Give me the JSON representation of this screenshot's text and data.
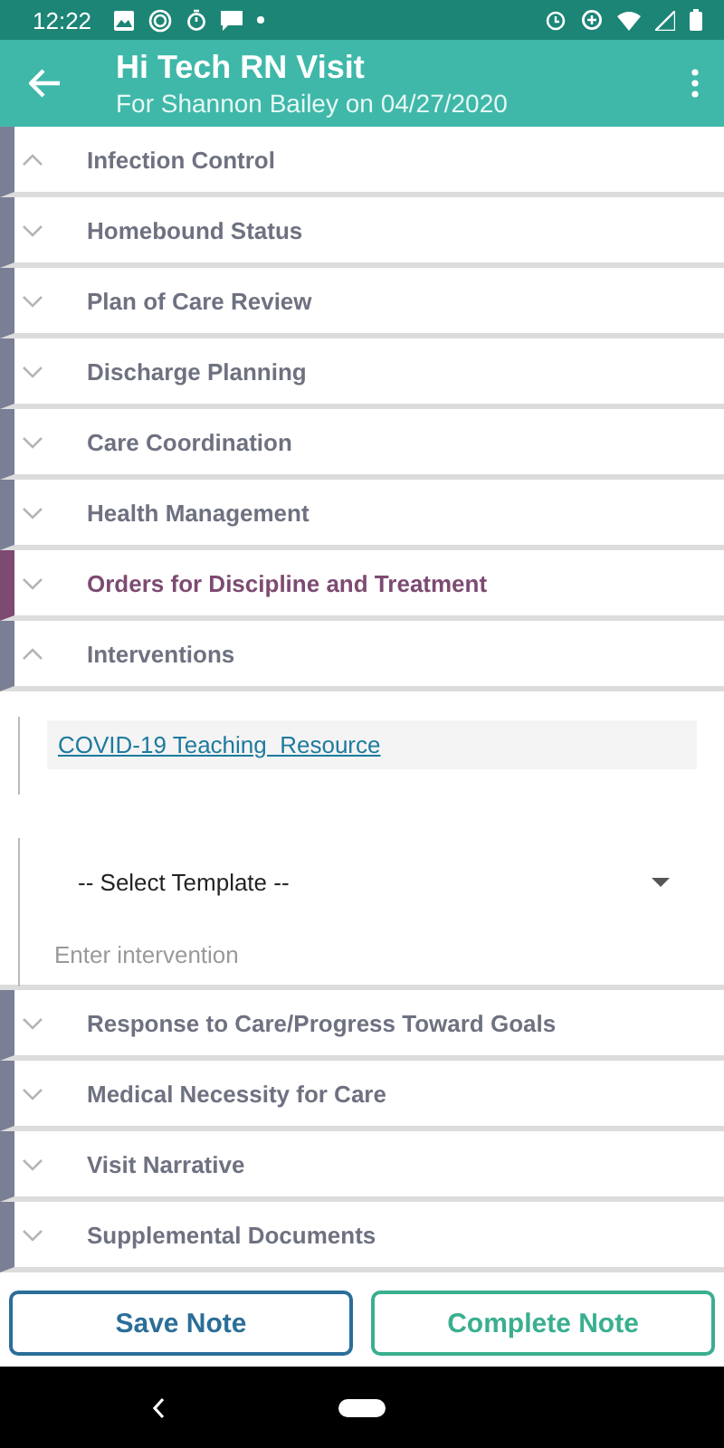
{
  "status_bar": {
    "time": "12:22"
  },
  "app_bar": {
    "title": "Hi Tech RN Visit",
    "subtitle": "For Shannon Bailey on 04/27/2020"
  },
  "sections": [
    {
      "title": "Infection Control",
      "expanded": true,
      "color": "#7a7f96"
    },
    {
      "title": "Homebound Status",
      "expanded": false,
      "color": "#7a7f96"
    },
    {
      "title": "Plan of Care Review",
      "expanded": false,
      "color": "#7a7f96"
    },
    {
      "title": "Discharge Planning",
      "expanded": false,
      "color": "#7a7f96"
    },
    {
      "title": "Care Coordination",
      "expanded": false,
      "color": "#7a7f96"
    },
    {
      "title": "Health Management",
      "expanded": false,
      "color": "#7a7f96"
    },
    {
      "title": "Orders for Discipline and Treatment",
      "expanded": false,
      "color": "#7d4a72"
    },
    {
      "title": "Interventions",
      "expanded": true,
      "color": "#7a7f96",
      "content": {
        "link": "COVID-19 Teaching  Resource",
        "select": "-- Select Template --",
        "placeholder": "Enter intervention"
      }
    },
    {
      "title": "Response to Care/Progress Toward Goals",
      "expanded": false,
      "color": "#7a7f96"
    },
    {
      "title": "Medical Necessity for Care",
      "expanded": false,
      "color": "#7a7f96"
    },
    {
      "title": "Visit Narrative",
      "expanded": false,
      "color": "#7a7f96"
    },
    {
      "title": "Supplemental Documents",
      "expanded": false,
      "color": "#7a7f96"
    }
  ],
  "buttons": [
    {
      "label": "Save Note",
      "kind": "save"
    },
    {
      "label": "Complete Note",
      "kind": "complete"
    }
  ]
}
